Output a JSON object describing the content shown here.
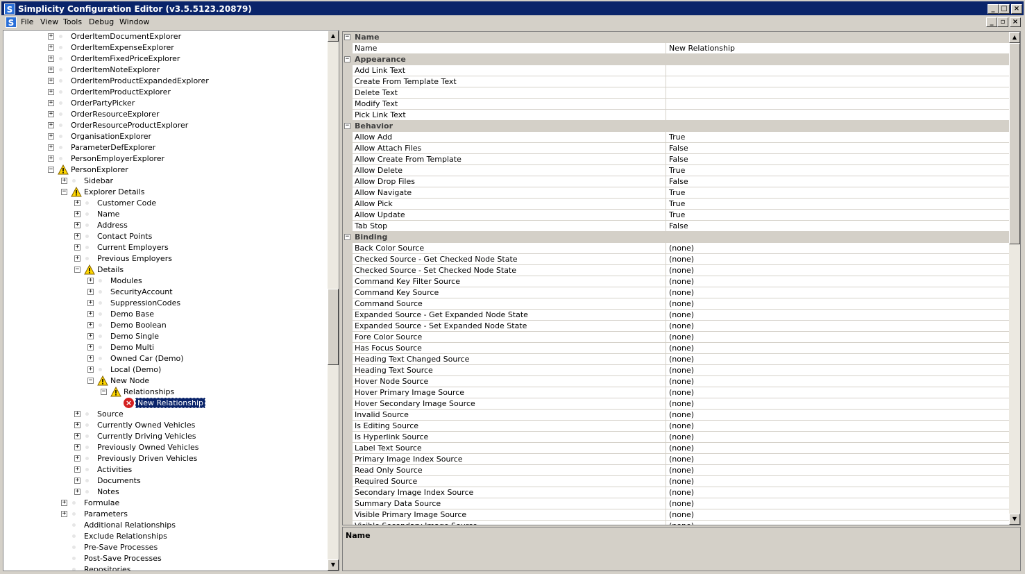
{
  "window": {
    "title": "Simplicity Configuration Editor (v3.5.5123.20879)",
    "app_icon": "S",
    "buttons": [
      "_",
      "□",
      "×"
    ]
  },
  "menu": {
    "icon": "S",
    "items": [
      "File",
      "View",
      "Tools",
      "Debug",
      "Window"
    ],
    "mdi_buttons": [
      "_",
      "▫",
      "×"
    ]
  },
  "tree": {
    "nodes": [
      {
        "label": "OrderItemDocumentExplorer",
        "level": 3,
        "expander": "+",
        "icon": "dot"
      },
      {
        "label": "OrderItemExpenseExplorer",
        "level": 3,
        "expander": "+",
        "icon": "dot"
      },
      {
        "label": "OrderItemFixedPriceExplorer",
        "level": 3,
        "expander": "+",
        "icon": "dot"
      },
      {
        "label": "OrderItemNoteExplorer",
        "level": 3,
        "expander": "+",
        "icon": "dot"
      },
      {
        "label": "OrderItemProductExpandedExplorer",
        "level": 3,
        "expander": "+",
        "icon": "dot"
      },
      {
        "label": "OrderItemProductExplorer",
        "level": 3,
        "expander": "+",
        "icon": "dot"
      },
      {
        "label": "OrderPartyPicker",
        "level": 3,
        "expander": "+",
        "icon": "dot"
      },
      {
        "label": "OrderResourceExplorer",
        "level": 3,
        "expander": "+",
        "icon": "dot"
      },
      {
        "label": "OrderResourceProductExplorer",
        "level": 3,
        "expander": "+",
        "icon": "dot"
      },
      {
        "label": "OrganisationExplorer",
        "level": 3,
        "expander": "+",
        "icon": "dot"
      },
      {
        "label": "ParameterDefExplorer",
        "level": 3,
        "expander": "+",
        "icon": "dot"
      },
      {
        "label": "PersonEmployerExplorer",
        "level": 3,
        "expander": "+",
        "icon": "dot"
      },
      {
        "label": "PersonExplorer",
        "level": 3,
        "expander": "−",
        "icon": "warning"
      },
      {
        "label": "Sidebar",
        "level": 4,
        "expander": "+",
        "icon": "dot"
      },
      {
        "label": "Explorer Details",
        "level": 4,
        "expander": "−",
        "icon": "warning"
      },
      {
        "label": "Customer Code",
        "level": 5,
        "expander": "+",
        "icon": "dot"
      },
      {
        "label": "Name",
        "level": 5,
        "expander": "+",
        "icon": "dot"
      },
      {
        "label": "Address",
        "level": 5,
        "expander": "+",
        "icon": "dot"
      },
      {
        "label": "Contact Points",
        "level": 5,
        "expander": "+",
        "icon": "dot"
      },
      {
        "label": "Current Employers",
        "level": 5,
        "expander": "+",
        "icon": "dot"
      },
      {
        "label": "Previous Employers",
        "level": 5,
        "expander": "+",
        "icon": "dot"
      },
      {
        "label": "Details",
        "level": 5,
        "expander": "−",
        "icon": "warning"
      },
      {
        "label": "Modules",
        "level": 6,
        "expander": "+",
        "icon": "dot"
      },
      {
        "label": "SecurityAccount",
        "level": 6,
        "expander": "+",
        "icon": "dot"
      },
      {
        "label": "SuppressionCodes",
        "level": 6,
        "expander": "+",
        "icon": "dot"
      },
      {
        "label": "Demo Base",
        "level": 6,
        "expander": "+",
        "icon": "dot"
      },
      {
        "label": "Demo Boolean",
        "level": 6,
        "expander": "+",
        "icon": "dot"
      },
      {
        "label": "Demo Single",
        "level": 6,
        "expander": "+",
        "icon": "dot"
      },
      {
        "label": "Demo Multi",
        "level": 6,
        "expander": "+",
        "icon": "dot"
      },
      {
        "label": "Owned Car (Demo)",
        "level": 6,
        "expander": "+",
        "icon": "dot"
      },
      {
        "label": "Local (Demo)",
        "level": 6,
        "expander": "+",
        "icon": "dot"
      },
      {
        "label": "New Node",
        "level": 6,
        "expander": "−",
        "icon": "warning"
      },
      {
        "label": "Relationships",
        "level": 7,
        "expander": "−",
        "icon": "warning"
      },
      {
        "label": "New Relationship",
        "level": 8,
        "expander": "",
        "icon": "error",
        "selected": true
      },
      {
        "label": "Source",
        "level": 5,
        "expander": "+",
        "icon": "dot"
      },
      {
        "label": "Currently Owned Vehicles",
        "level": 5,
        "expander": "+",
        "icon": "dot"
      },
      {
        "label": "Currently Driving Vehicles",
        "level": 5,
        "expander": "+",
        "icon": "dot"
      },
      {
        "label": "Previously Owned Vehicles",
        "level": 5,
        "expander": "+",
        "icon": "dot"
      },
      {
        "label": "Previously Driven Vehicles",
        "level": 5,
        "expander": "+",
        "icon": "dot"
      },
      {
        "label": "Activities",
        "level": 5,
        "expander": "+",
        "icon": "dot"
      },
      {
        "label": "Documents",
        "level": 5,
        "expander": "+",
        "icon": "dot"
      },
      {
        "label": "Notes",
        "level": 5,
        "expander": "+",
        "icon": "dot"
      },
      {
        "label": "Formulae",
        "level": 4,
        "expander": "+",
        "icon": "dot"
      },
      {
        "label": "Parameters",
        "level": 4,
        "expander": "+",
        "icon": "dot"
      },
      {
        "label": "Additional Relationships",
        "level": 4,
        "expander": "",
        "icon": "dot"
      },
      {
        "label": "Exclude Relationships",
        "level": 4,
        "expander": "",
        "icon": "dot"
      },
      {
        "label": "Pre-Save Processes",
        "level": 4,
        "expander": "",
        "icon": "dot"
      },
      {
        "label": "Post-Save Processes",
        "level": 4,
        "expander": "",
        "icon": "dot"
      },
      {
        "label": "Repositories",
        "level": 4,
        "expander": "",
        "icon": "dot"
      }
    ]
  },
  "property_grid": {
    "categories": [
      {
        "name": "Name",
        "rows": [
          [
            "Name",
            "New Relationship"
          ]
        ]
      },
      {
        "name": "Appearance",
        "rows": [
          [
            "Add Link Text",
            ""
          ],
          [
            "Create From Template Text",
            ""
          ],
          [
            "Delete Text",
            ""
          ],
          [
            "Modify Text",
            ""
          ],
          [
            "Pick Link Text",
            ""
          ]
        ]
      },
      {
        "name": "Behavior",
        "rows": [
          [
            "Allow Add",
            "True"
          ],
          [
            "Allow Attach Files",
            "False"
          ],
          [
            "Allow Create From Template",
            "False"
          ],
          [
            "Allow Delete",
            "True"
          ],
          [
            "Allow Drop Files",
            "False"
          ],
          [
            "Allow Navigate",
            "True"
          ],
          [
            "Allow Pick",
            "True"
          ],
          [
            "Allow Update",
            "True"
          ],
          [
            "Tab Stop",
            "False"
          ]
        ]
      },
      {
        "name": "Binding",
        "rows": [
          [
            "Back Color Source",
            "(none)"
          ],
          [
            "Checked Source - Get Checked Node State",
            "(none)"
          ],
          [
            "Checked Source - Set Checked Node State",
            "(none)"
          ],
          [
            "Command Key Filter Source",
            "(none)"
          ],
          [
            "Command Key Source",
            "(none)"
          ],
          [
            "Command Source",
            "(none)"
          ],
          [
            "Expanded Source - Get Expanded Node State",
            "(none)"
          ],
          [
            "Expanded Source - Set Expanded Node State",
            "(none)"
          ],
          [
            "Fore Color Source",
            "(none)"
          ],
          [
            "Has Focus Source",
            "(none)"
          ],
          [
            "Heading Text Changed Source",
            "(none)"
          ],
          [
            "Heading Text Source",
            "(none)"
          ],
          [
            "Hover Node Source",
            "(none)"
          ],
          [
            "Hover Primary Image Source",
            "(none)"
          ],
          [
            "Hover Secondary Image Source",
            "(none)"
          ],
          [
            "Invalid Source",
            "(none)"
          ],
          [
            "Is Editing Source",
            "(none)"
          ],
          [
            "Is Hyperlink Source",
            "(none)"
          ],
          [
            "Label Text Source",
            "(none)"
          ],
          [
            "Primary Image Index Source",
            "(none)"
          ],
          [
            "Read Only Source",
            "(none)"
          ],
          [
            "Required Source",
            "(none)"
          ],
          [
            "Secondary Image Index Source",
            "(none)"
          ],
          [
            "Summary Data Source",
            "(none)"
          ],
          [
            "Visible Primary Image Source",
            "(none)"
          ],
          [
            "Visible Secondary Image Source",
            "(none)"
          ]
        ]
      }
    ],
    "description_title": "Name"
  },
  "colors": {
    "titlebar": "#0a246a",
    "selection": "#0a246a",
    "error": "#d42020",
    "warning": "#ffd700"
  }
}
